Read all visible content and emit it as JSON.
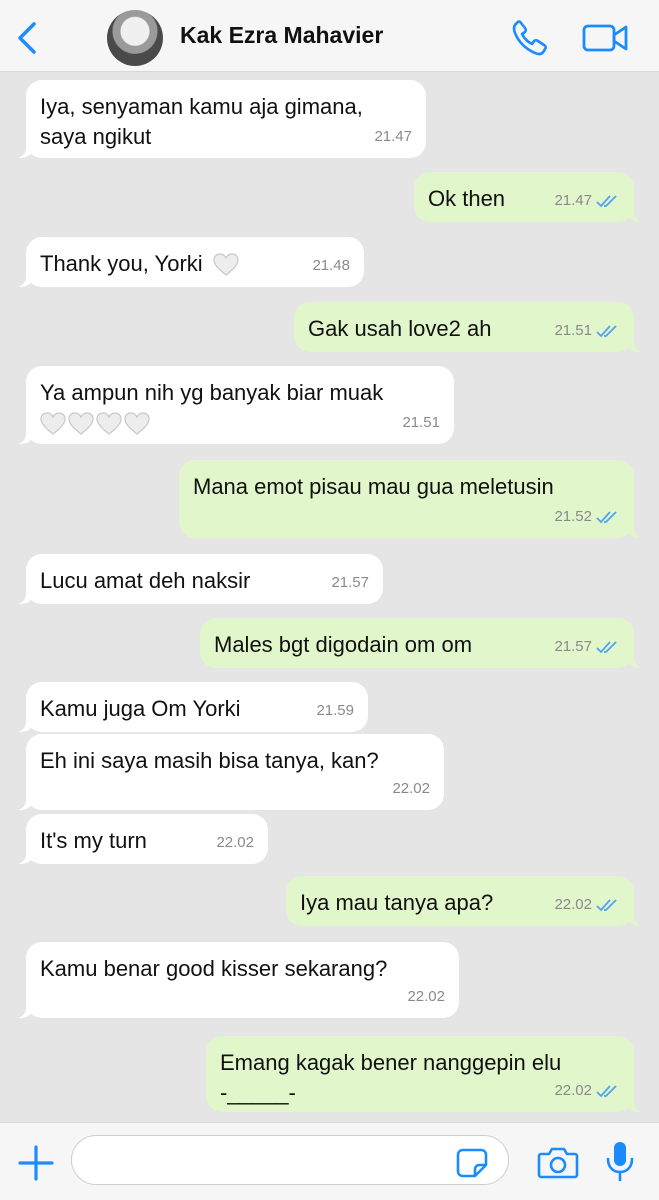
{
  "header": {
    "contact_name": "Kak Ezra Mahavier",
    "back_icon": "chevron-left-icon",
    "call_icon": "phone-icon",
    "video_icon": "video-camera-icon"
  },
  "colors": {
    "accent": "#1a8cff",
    "incoming_bubble": "#ffffff",
    "outgoing_bubble": "#e1f6cb",
    "chat_background": "#e5e5e5",
    "read_ticks": "#4fa3f7"
  },
  "messages": [
    {
      "dir": "in",
      "text": "Iya, senyaman kamu aja gimana,\nsaya ngikut",
      "time": "21.47"
    },
    {
      "dir": "out",
      "text": "Ok then",
      "time": "21.47",
      "read": true
    },
    {
      "dir": "in",
      "text": "Thank you, Yorki",
      "time": "21.48",
      "emoji": "white-heart-icon",
      "emoji_count": 1
    },
    {
      "dir": "out",
      "text": "Gak usah love2 ah",
      "time": "21.51",
      "read": true
    },
    {
      "dir": "in",
      "text": "Ya ampun nih yg banyak biar muak",
      "time": "21.51",
      "emoji": "white-heart-icon",
      "emoji_count": 4
    },
    {
      "dir": "out",
      "text": "Mana emot pisau mau gua meletusin",
      "time": "21.52",
      "read": true
    },
    {
      "dir": "in",
      "text": "Lucu amat deh naksir",
      "time": "21.57"
    },
    {
      "dir": "out",
      "text": "Males bgt digodain om om",
      "time": "21.57",
      "read": true
    },
    {
      "dir": "in",
      "text": "Kamu juga Om Yorki",
      "time": "21.59"
    },
    {
      "dir": "in",
      "text": "Eh ini saya masih bisa tanya, kan?",
      "time": "22.02"
    },
    {
      "dir": "in",
      "text": "It's my turn",
      "time": "22.02"
    },
    {
      "dir": "out",
      "text": "Iya mau tanya apa?",
      "time": "22.02",
      "read": true
    },
    {
      "dir": "in",
      "text": "Kamu benar good kisser sekarang?",
      "time": "22.02"
    },
    {
      "dir": "out",
      "text": "Emang kagak bener nanggepin elu\n-_____-",
      "time": "22.02",
      "read": true
    }
  ],
  "composer": {
    "input_value": "",
    "add_icon": "plus-icon",
    "sticker_icon": "sticker-icon",
    "camera_icon": "camera-icon",
    "mic_icon": "microphone-icon"
  }
}
